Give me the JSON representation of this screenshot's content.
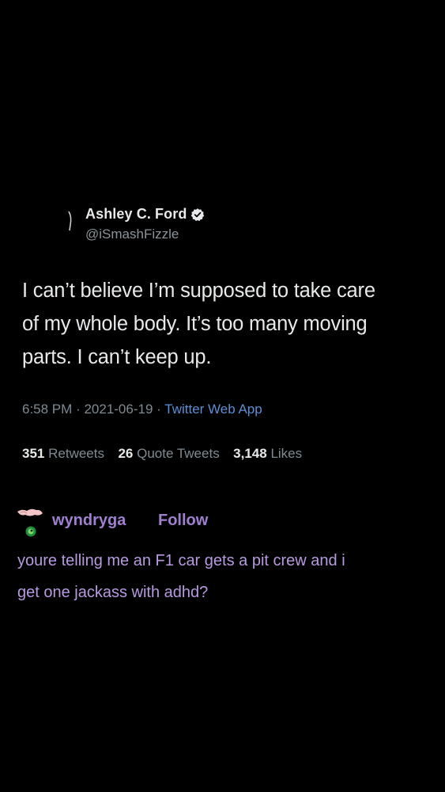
{
  "tweet": {
    "author_name": "Ashley C. Ford",
    "author_handle": "@iSmashFizzle",
    "text_lines": [
      "I can’t believe I’m supposed to take care",
      "of my whole body. It’s too many moving",
      "parts. I can’t keep up."
    ],
    "time": "6:58 PM",
    "date": "2021-06-19",
    "source": "Twitter Web App",
    "separator": "·",
    "stats": {
      "retweets_count": "351",
      "retweets_label": "Retweets",
      "quote_tweets_count": "26",
      "quote_tweets_label": "Quote Tweets",
      "likes_count": "3,148",
      "likes_label": "Likes"
    }
  },
  "reply": {
    "username": "wyndryga",
    "follow_label": "Follow",
    "text_lines": [
      "youre telling me an F1 car gets a pit crew and i",
      "get one jackass with adhd?"
    ]
  },
  "colors": {
    "background": "#000000",
    "tweet_text": "#e7e9ea",
    "muted": "#7f8a92",
    "link_blue": "#5b8fd6",
    "reply_purple": "#a07fd0",
    "reply_text": "#b79ae0"
  },
  "icons": {
    "verified": "verified-badge-icon",
    "reply_avatar": "avatar"
  }
}
